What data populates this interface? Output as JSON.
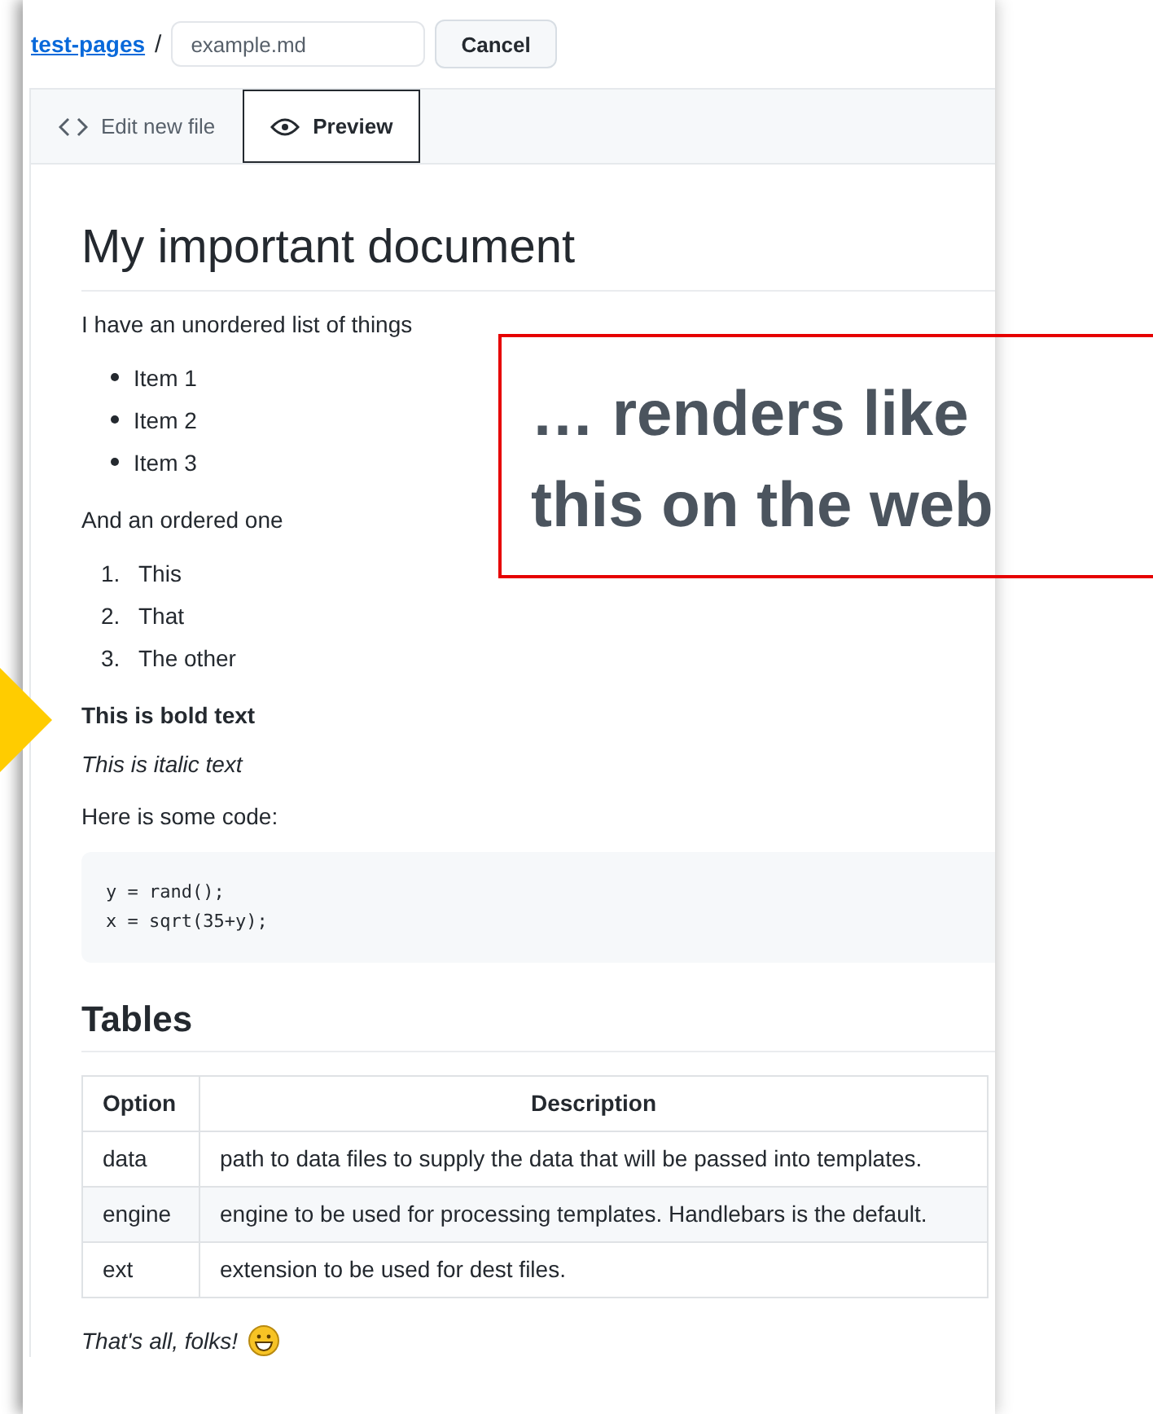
{
  "breadcrumb": {
    "link": "test-pages",
    "separator": "/",
    "filename": "example.md",
    "cancel": "Cancel"
  },
  "tabs": [
    {
      "label": "Edit new file",
      "kind": "code",
      "selected": false
    },
    {
      "label": "Preview",
      "kind": "eye",
      "selected": true
    }
  ],
  "document": {
    "title": "My important document",
    "intro": "I have an unordered list of things",
    "bullets": [
      "Item 1",
      "Item 2",
      "Item 3"
    ],
    "ordered_intro": "And an ordered one",
    "ordered": [
      {
        "number": "1.",
        "text": "This"
      },
      {
        "number": "2.",
        "text": "That"
      },
      {
        "number": "3.",
        "text": "The other"
      }
    ],
    "bold_text": "This is bold text",
    "italic_text": "This is italic text",
    "code_intro": "Here is some code:",
    "code": [
      "y = rand();",
      "x = sqrt(35+y);"
    ],
    "tables_heading": "Tables",
    "table": {
      "columns": [
        "Option",
        "Description"
      ],
      "rows": [
        [
          "data",
          "path to data files to supply the data that will be passed into templates."
        ],
        [
          "engine",
          "engine to be used for processing templates. Handlebars is the default."
        ],
        [
          "ext",
          "extension to be used for dest files."
        ]
      ]
    },
    "closing": "That's all, folks!"
  },
  "annotation": {
    "text": "… renders like this on the web"
  }
}
